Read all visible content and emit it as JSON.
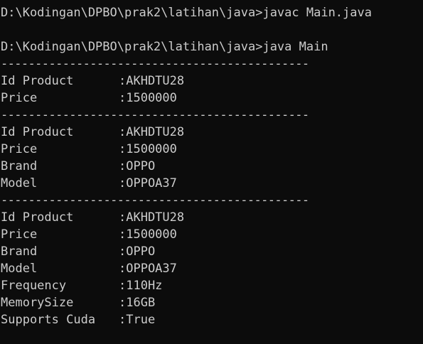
{
  "terminal": {
    "colors": {
      "background": "#0c0c0c",
      "foreground": "#cccccc"
    },
    "commands": [
      "D:\\Kodingan\\DPBO\\prak2\\latihan\\java>javac Main.java",
      "D:\\Kodingan\\DPBO\\prak2\\latihan\\java>java Main"
    ],
    "separator": "---------------------------------------------",
    "blocks": [
      {
        "rows": [
          {
            "label": "Id Product",
            "value": ":AKHDTU28"
          },
          {
            "label": "Price",
            "value": ":1500000"
          }
        ]
      },
      {
        "rows": [
          {
            "label": "Id Product",
            "value": ":AKHDTU28"
          },
          {
            "label": "Price",
            "value": ":1500000"
          },
          {
            "label": "Brand",
            "value": ":OPPO"
          },
          {
            "label": "Model",
            "value": ":OPPOA37"
          }
        ]
      },
      {
        "rows": [
          {
            "label": "Id Product",
            "value": ":AKHDTU28"
          },
          {
            "label": "Price",
            "value": ":1500000"
          },
          {
            "label": "Brand",
            "value": ":OPPO"
          },
          {
            "label": "Model",
            "value": ":OPPOA37"
          },
          {
            "label": "Frequency",
            "value": ":110Hz"
          },
          {
            "label": "MemorySize",
            "value": ":16GB"
          },
          {
            "label": "Supports Cuda",
            "value": ":True"
          }
        ]
      }
    ]
  }
}
